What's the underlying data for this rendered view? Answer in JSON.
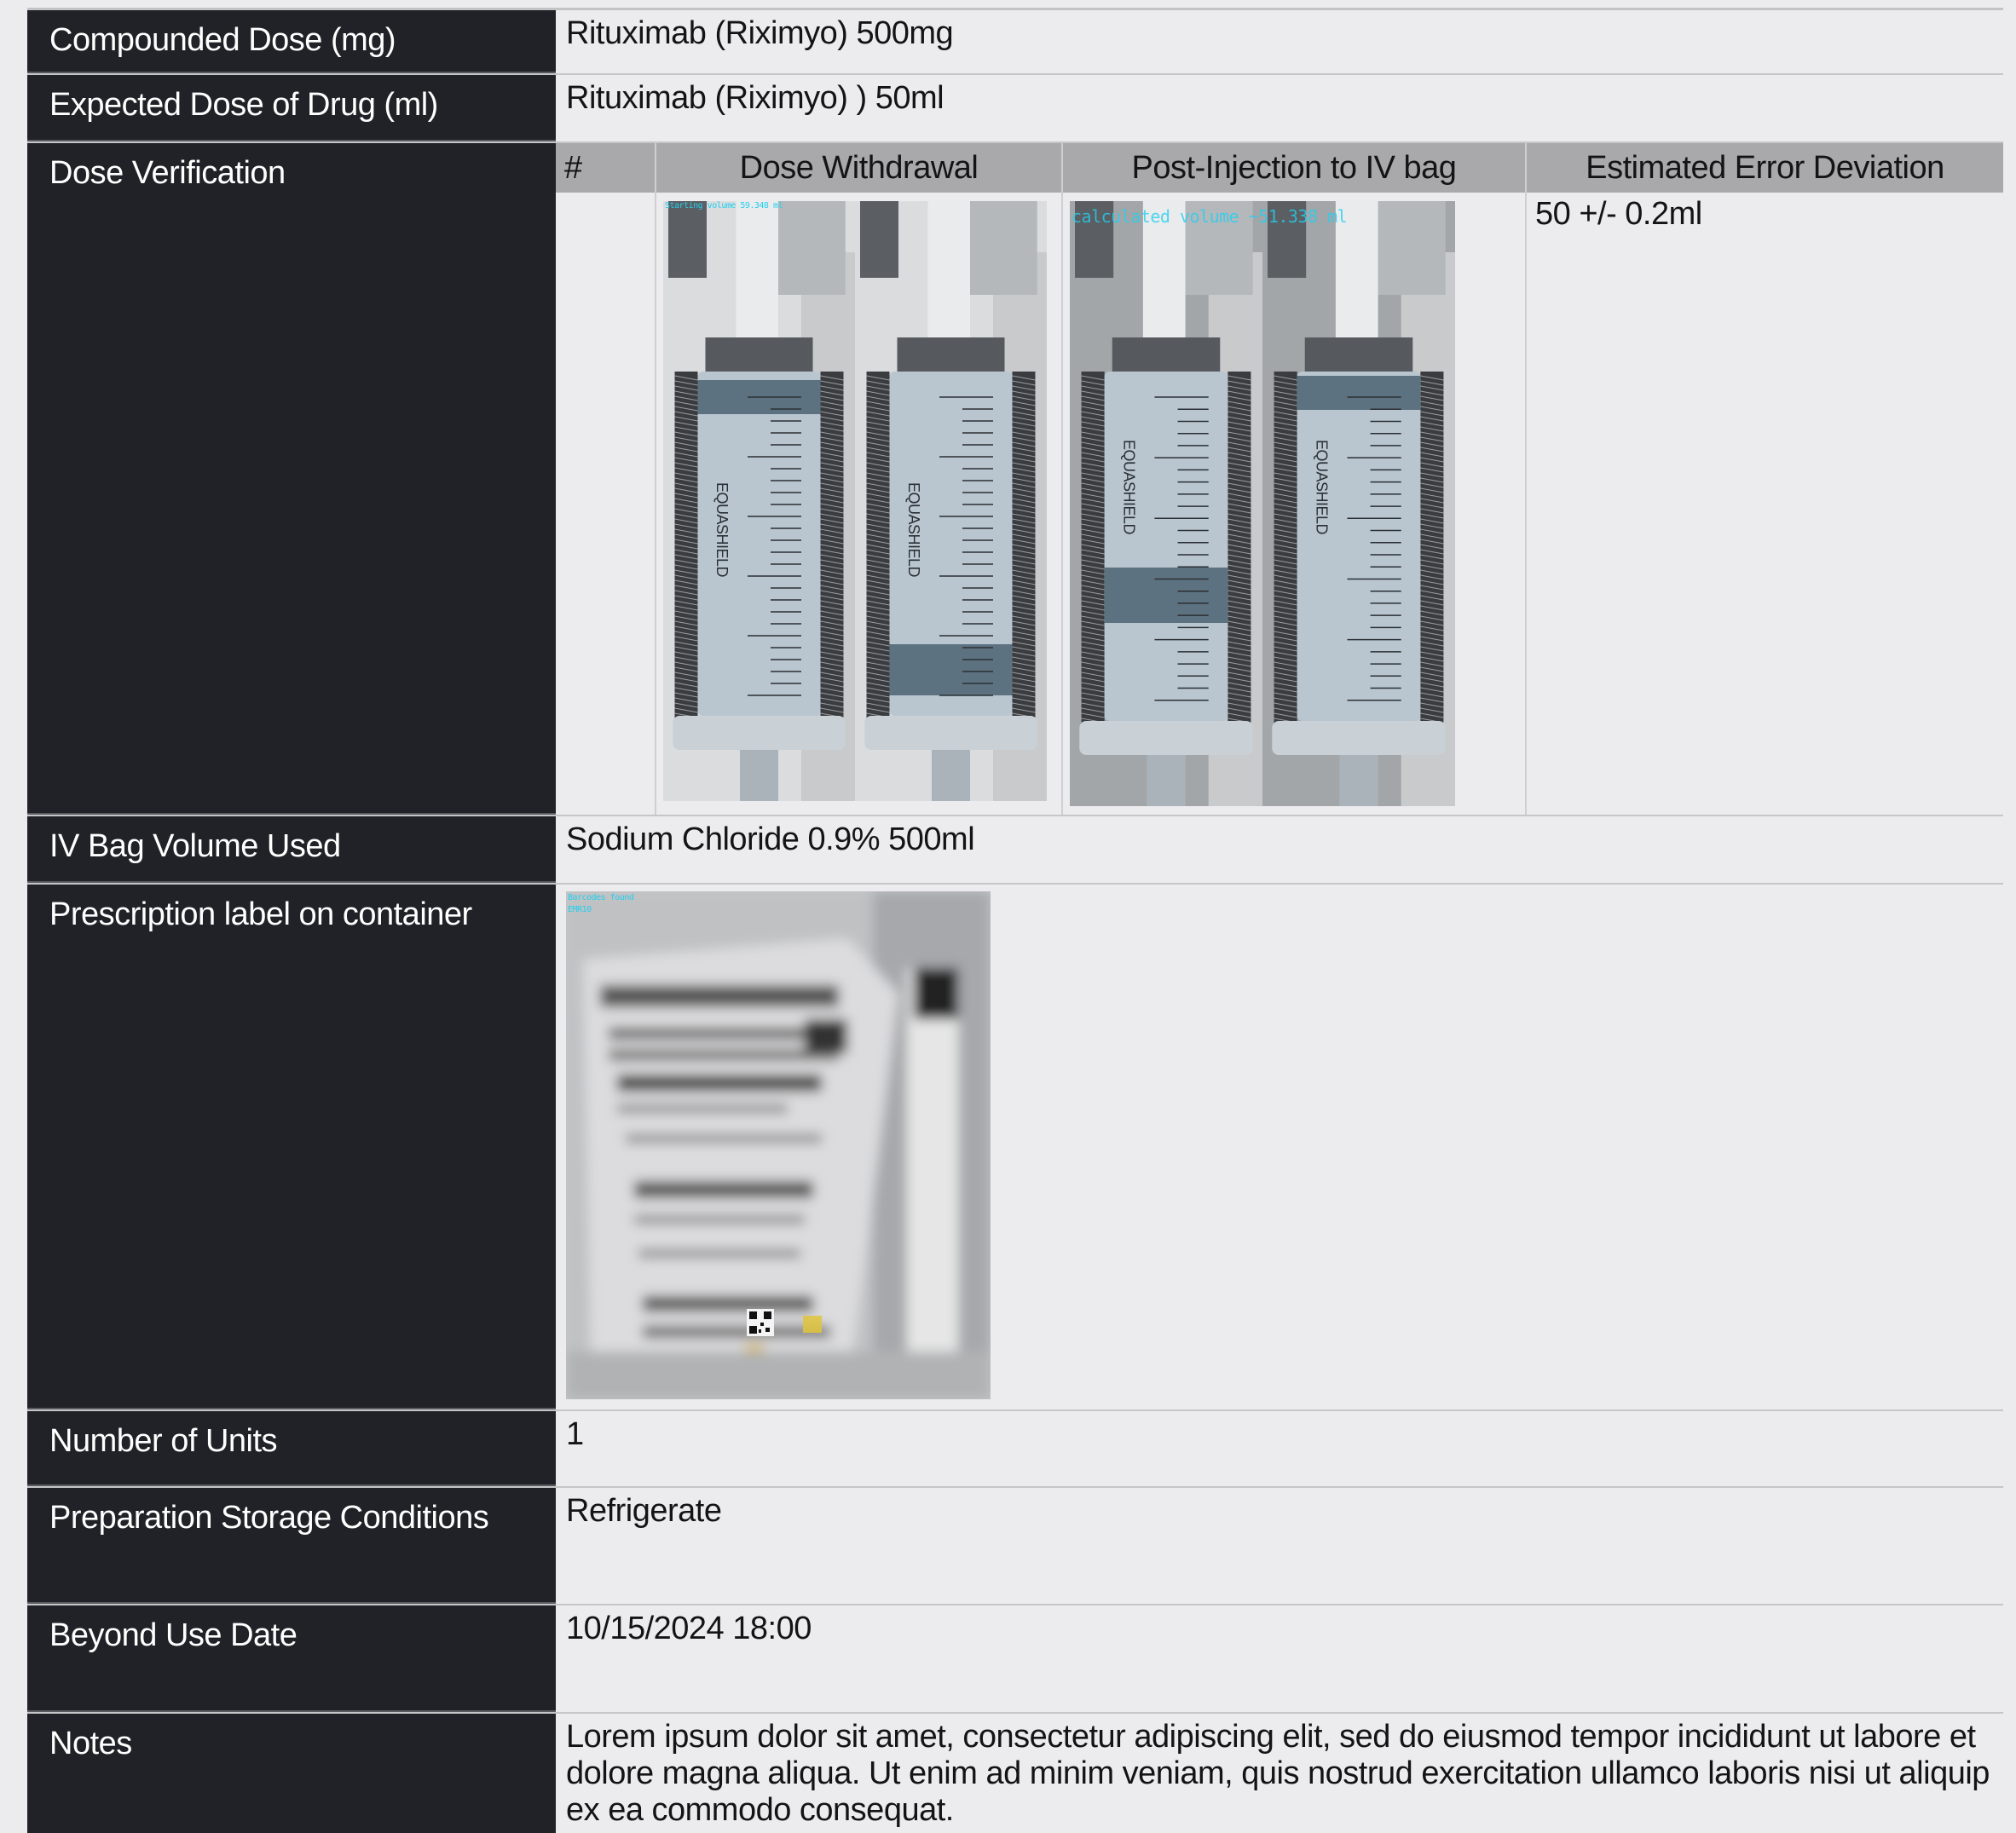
{
  "rows": {
    "compounded": {
      "label": "Compounded Dose (mg)",
      "value": "Rituximab (Riximyo) 500mg"
    },
    "expected": {
      "label": "Expected Dose of Drug (ml)",
      "value": "Rituximab (Riximyo) ) 50ml"
    },
    "dose": {
      "label": "Dose Verification",
      "headers": {
        "num": "#",
        "withdrawal": "Dose Withdrawal",
        "post": "Post-Injection to IV bag",
        "error": "Estimated Error Deviation"
      },
      "num_value": "",
      "error_value": "50 +/- 0.2ml",
      "withdrawal_overlay": "Starting volume 59.348 ml",
      "post_overlay": "calculated volume  ~51.338 ml",
      "syringe_brand": "EQUASHIELD"
    },
    "ivbag": {
      "label": "IV Bag Volume Used",
      "value": "Sodium Chloride 0.9% 500ml"
    },
    "rxlabel": {
      "label": "Prescription label on container",
      "overlay_line1": "Barcodes found",
      "overlay_line2": "EMR10"
    },
    "units": {
      "label": "Number of Units",
      "value": "1"
    },
    "storage": {
      "label": "Preparation Storage Conditions",
      "value": "Refrigerate"
    },
    "bud": {
      "label": "Beyond Use Date",
      "value": "10/15/2024 18:00"
    },
    "notes": {
      "label": "Notes",
      "value": "Lorem ipsum dolor sit amet, consectetur adipiscing elit, sed do eiusmod tempor incididunt ut labore et dolore magna aliqua. Ut enim ad minim veniam, quis nostrud exercitation ullamco laboris nisi ut aliquip ex ea commodo consequat."
    }
  },
  "colors": {
    "label_bg": "#212227",
    "page_bg": "#ececee",
    "header_bg": "#a9a9ac",
    "overlay_text": "#24d0f0"
  }
}
